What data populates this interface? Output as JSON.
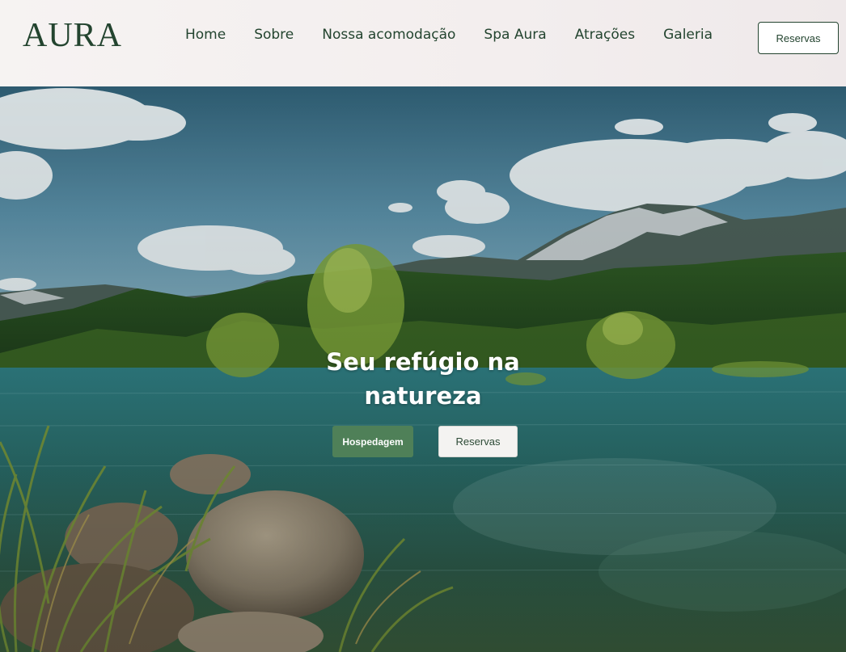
{
  "brand": {
    "logo_text": "AURA"
  },
  "nav": {
    "items": [
      {
        "label": "Home"
      },
      {
        "label": "Sobre"
      },
      {
        "label": "Nossa acomodação"
      },
      {
        "label": "Spa Aura"
      },
      {
        "label": "Atrações"
      },
      {
        "label": "Galeria"
      }
    ],
    "cta_label": "Reservas"
  },
  "hero": {
    "title_line1": "Seu refúgio na",
    "title_line2": "natureza",
    "primary_button": "Hospedagem",
    "secondary_button": "Reservas"
  },
  "colors": {
    "brand_green": "#23442f",
    "button_green": "#4f8058",
    "header_bg": "#f3eeee"
  }
}
